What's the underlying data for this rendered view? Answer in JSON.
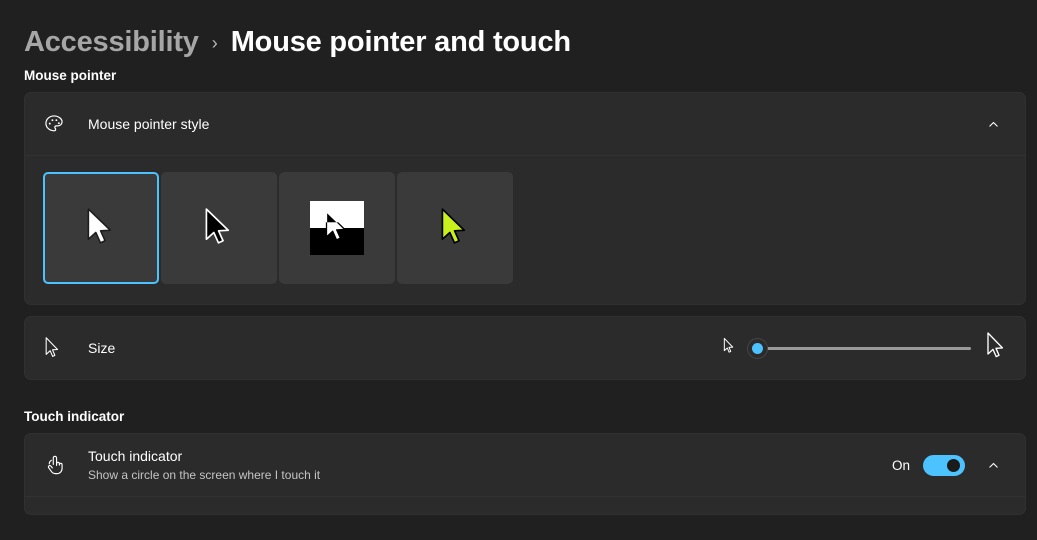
{
  "breadcrumb": {
    "parent": "Accessibility",
    "separator": "›",
    "current": "Mouse pointer and touch"
  },
  "sections": {
    "mouse_pointer": {
      "heading": "Mouse pointer",
      "style_row": {
        "icon": "palette-icon",
        "title": "Mouse pointer style",
        "expand_icon": "chevron-up-icon",
        "expanded": "true"
      },
      "styles": [
        {
          "name": "White",
          "selected": "true"
        },
        {
          "name": "Black",
          "selected": "false"
        },
        {
          "name": "Inverted",
          "selected": "false"
        },
        {
          "name": "Custom",
          "selected": "false",
          "color": "#c9f01c"
        }
      ],
      "size_row": {
        "icon": "pointer-outline-icon",
        "title": "Size",
        "slider_value": "1",
        "slider_min": "1",
        "slider_max": "15",
        "small_icon": "small-pointer-icon",
        "large_icon": "large-pointer-icon"
      }
    },
    "touch_indicator": {
      "heading": "Touch indicator",
      "row": {
        "icon": "touch-tap-icon",
        "title": "Touch indicator",
        "subtitle": "Show a circle on the screen where I touch it",
        "toggle_state_label": "On",
        "toggle_on": "true",
        "expand_icon": "chevron-up-icon"
      }
    }
  },
  "colors": {
    "accent": "#4cc2ff",
    "page_background": "#202020",
    "card_background": "#2b2b2b",
    "tile_background": "#3a3a3a"
  }
}
